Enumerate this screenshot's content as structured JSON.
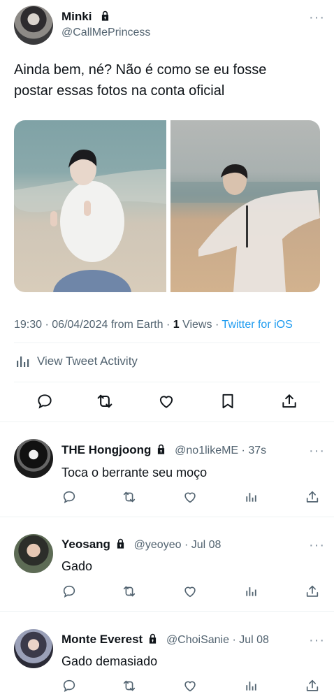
{
  "main_tweet": {
    "author_name": "Minki",
    "author_handle": "@CallMePrincess",
    "text_line1": "Ainda bem, né? Não é como se eu fosse",
    "text_line2": "postar essas fotos na conta oficial",
    "time": "19:30",
    "date": "06/04/2024",
    "location_text": "from Earth",
    "views_count": "1",
    "views_label": "Views",
    "source": "Twitter for iOS",
    "activity_label": "View Tweet Activity"
  },
  "replies": [
    {
      "name": "THE Hongjoong",
      "handle": "@no1likeME",
      "time": "37s",
      "text": "Toca o berrante seu moço"
    },
    {
      "name": "Yeosang",
      "handle": "@yeoyeo",
      "time": "Jul 08",
      "text": "Gado"
    },
    {
      "name": "Monte Everest",
      "handle": "@ChoiSanie",
      "time": "Jul 08",
      "text": "Gado demasiado"
    }
  ],
  "icons": [
    "reply-icon",
    "retweet-icon",
    "like-icon",
    "bookmark-icon",
    "share-icon",
    "views-icon",
    "lock-icon",
    "more-icon"
  ],
  "colors": {
    "link": "#1d9bf0",
    "secondary": "#536471",
    "icon": "#0f1419"
  }
}
